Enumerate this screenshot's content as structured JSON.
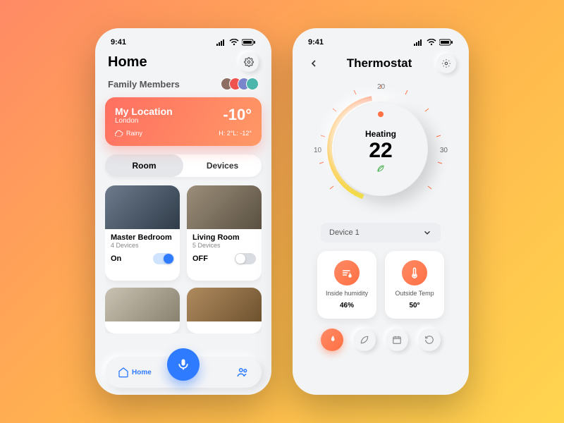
{
  "status": {
    "time": "9:41"
  },
  "home": {
    "title": "Home",
    "family_label": "Family Members",
    "weather": {
      "loc_title": "My Location",
      "city": "London",
      "temp": "-10°",
      "condition": "Rainy",
      "hl": "H: 2°L: -12°"
    },
    "tabs": {
      "room": "Room",
      "devices": "Devices"
    },
    "rooms": [
      {
        "name": "Master Bedroom",
        "sub": "4 Devices",
        "state": "On"
      },
      {
        "name": "Living Room",
        "sub": "5 Devices",
        "state": "OFF"
      }
    ],
    "nav": {
      "home": "Home"
    }
  },
  "thermo": {
    "title": "Thermostat",
    "scale": {
      "n10": "10",
      "n20": "20",
      "n30": "30"
    },
    "mode": "Heating",
    "setpoint": "22",
    "device_selected": "Device 1",
    "humidity": {
      "label": "Inside humidity",
      "value": "46%"
    },
    "outside": {
      "label": "Outside Temp",
      "value": "50°"
    }
  }
}
